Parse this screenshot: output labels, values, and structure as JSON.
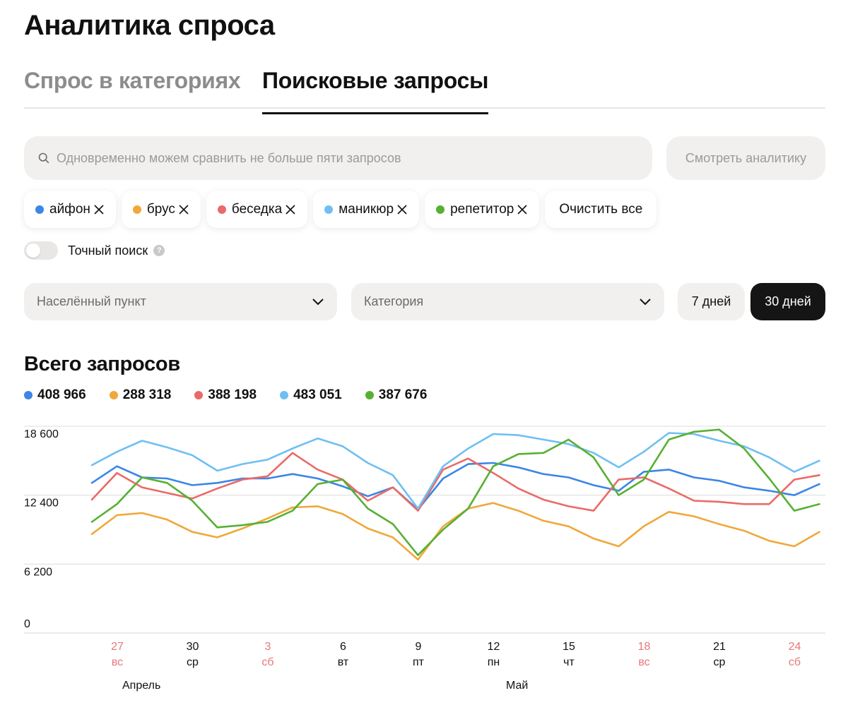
{
  "page": {
    "title": "Аналитика спроса"
  },
  "tabs": [
    {
      "label": "Спрос в категориях",
      "active": false
    },
    {
      "label": "Поисковые запросы",
      "active": true
    }
  ],
  "search": {
    "placeholder": "Одновременно можем сравнить не больше пяти запросов",
    "value": "",
    "icon": "search-icon",
    "submit_label": "Смотреть аналитику"
  },
  "chips": [
    {
      "label": "айфон",
      "color": "#3b86e6"
    },
    {
      "label": "брус",
      "color": "#f0a83a"
    },
    {
      "label": "беседка",
      "color": "#ea6a67"
    },
    {
      "label": "маникюр",
      "color": "#6fbff2"
    },
    {
      "label": "репетитор",
      "color": "#57b034"
    }
  ],
  "clear_all_label": "Очистить все",
  "exact_search": {
    "label": "Точный поиск",
    "enabled": false,
    "help_icon": "question-icon"
  },
  "filters": {
    "city": {
      "placeholder": "Населённый пункт"
    },
    "category": {
      "placeholder": "Категория"
    },
    "periods": [
      {
        "label": "7 дней",
        "selected": false
      },
      {
        "label": "30 дней",
        "selected": true
      }
    ]
  },
  "chart": {
    "title": "Всего запросов",
    "totals": [
      "408 966",
      "288 318",
      "388 198",
      "483 051",
      "387 676"
    ]
  },
  "chart_data": {
    "type": "line",
    "title": "Всего запросов",
    "ylim": [
      0,
      18600
    ],
    "yticks": [
      "18 600",
      "12 400",
      "6 200",
      "0"
    ],
    "x_days": [
      25,
      26,
      27,
      28,
      29,
      30,
      1,
      2,
      3,
      4,
      5,
      6,
      7,
      8,
      9,
      10,
      11,
      12,
      13,
      14,
      15,
      16,
      17,
      18,
      19,
      20,
      21,
      22,
      23,
      24,
      25
    ],
    "x_tick_labels": [
      {
        "day": "27",
        "weekday": "вс",
        "weekend": true
      },
      {
        "day": "30",
        "weekday": "ср",
        "weekend": false
      },
      {
        "day": "3",
        "weekday": "сб",
        "weekend": true
      },
      {
        "day": "6",
        "weekday": "вт",
        "weekend": false
      },
      {
        "day": "9",
        "weekday": "пт",
        "weekend": false
      },
      {
        "day": "12",
        "weekday": "пн",
        "weekend": false
      },
      {
        "day": "15",
        "weekday": "чт",
        "weekend": false
      },
      {
        "day": "18",
        "weekday": "вс",
        "weekend": true
      },
      {
        "day": "21",
        "weekday": "ср",
        "weekend": false
      },
      {
        "day": "24",
        "weekday": "сб",
        "weekend": true
      }
    ],
    "months": [
      "Апрель",
      "Май"
    ],
    "grid": true,
    "colors": {
      "weekend": "#e87878",
      "weekday": "#111111",
      "grid": "#dcdcdc"
    },
    "series": [
      {
        "name": "айфон",
        "color": "#3b86e6",
        "values": [
          13500,
          15000,
          14000,
          13900,
          13300,
          13500,
          13900,
          13900,
          14300,
          13900,
          13200,
          12300,
          13100,
          11100,
          13900,
          15200,
          15300,
          14900,
          14300,
          14000,
          13300,
          12800,
          14500,
          14700,
          14000,
          13700,
          13100,
          12800,
          12400,
          13400
        ]
      },
      {
        "name": "брус",
        "color": "#f0a83a",
        "values": [
          8900,
          10600,
          10800,
          10200,
          9100,
          8600,
          9400,
          10300,
          11300,
          11400,
          10700,
          9400,
          8600,
          6600,
          9600,
          11200,
          11700,
          11000,
          10100,
          9600,
          8500,
          7800,
          9600,
          10900,
          10500,
          9800,
          9200,
          8300,
          7800,
          9100
        ]
      },
      {
        "name": "беседка",
        "color": "#ea6a67",
        "values": [
          12000,
          14400,
          13100,
          12600,
          12100,
          13000,
          13800,
          14100,
          16200,
          14700,
          13800,
          11900,
          13100,
          11000,
          14700,
          15700,
          14400,
          13000,
          12000,
          11400,
          11000,
          13800,
          14000,
          13000,
          11900,
          11800,
          11600,
          11600,
          13800,
          14200
        ]
      },
      {
        "name": "маникюр",
        "color": "#6fbff2",
        "values": [
          15100,
          16300,
          17300,
          16700,
          16000,
          14600,
          15200,
          15600,
          16600,
          17500,
          16800,
          15300,
          14200,
          11200,
          15000,
          16600,
          17900,
          17800,
          17400,
          17000,
          16200,
          14900,
          16300,
          18000,
          17900,
          17300,
          16800,
          15800,
          14500,
          15500
        ]
      },
      {
        "name": "репетитор",
        "color": "#57b034",
        "values": [
          10000,
          11600,
          14000,
          13500,
          11900,
          9500,
          9700,
          10000,
          11000,
          13400,
          13800,
          11200,
          9800,
          7000,
          9300,
          11200,
          15000,
          16100,
          16200,
          17400,
          15800,
          12400,
          13800,
          17400,
          18100,
          18300,
          16600,
          13900,
          11000,
          11600
        ]
      }
    ]
  }
}
